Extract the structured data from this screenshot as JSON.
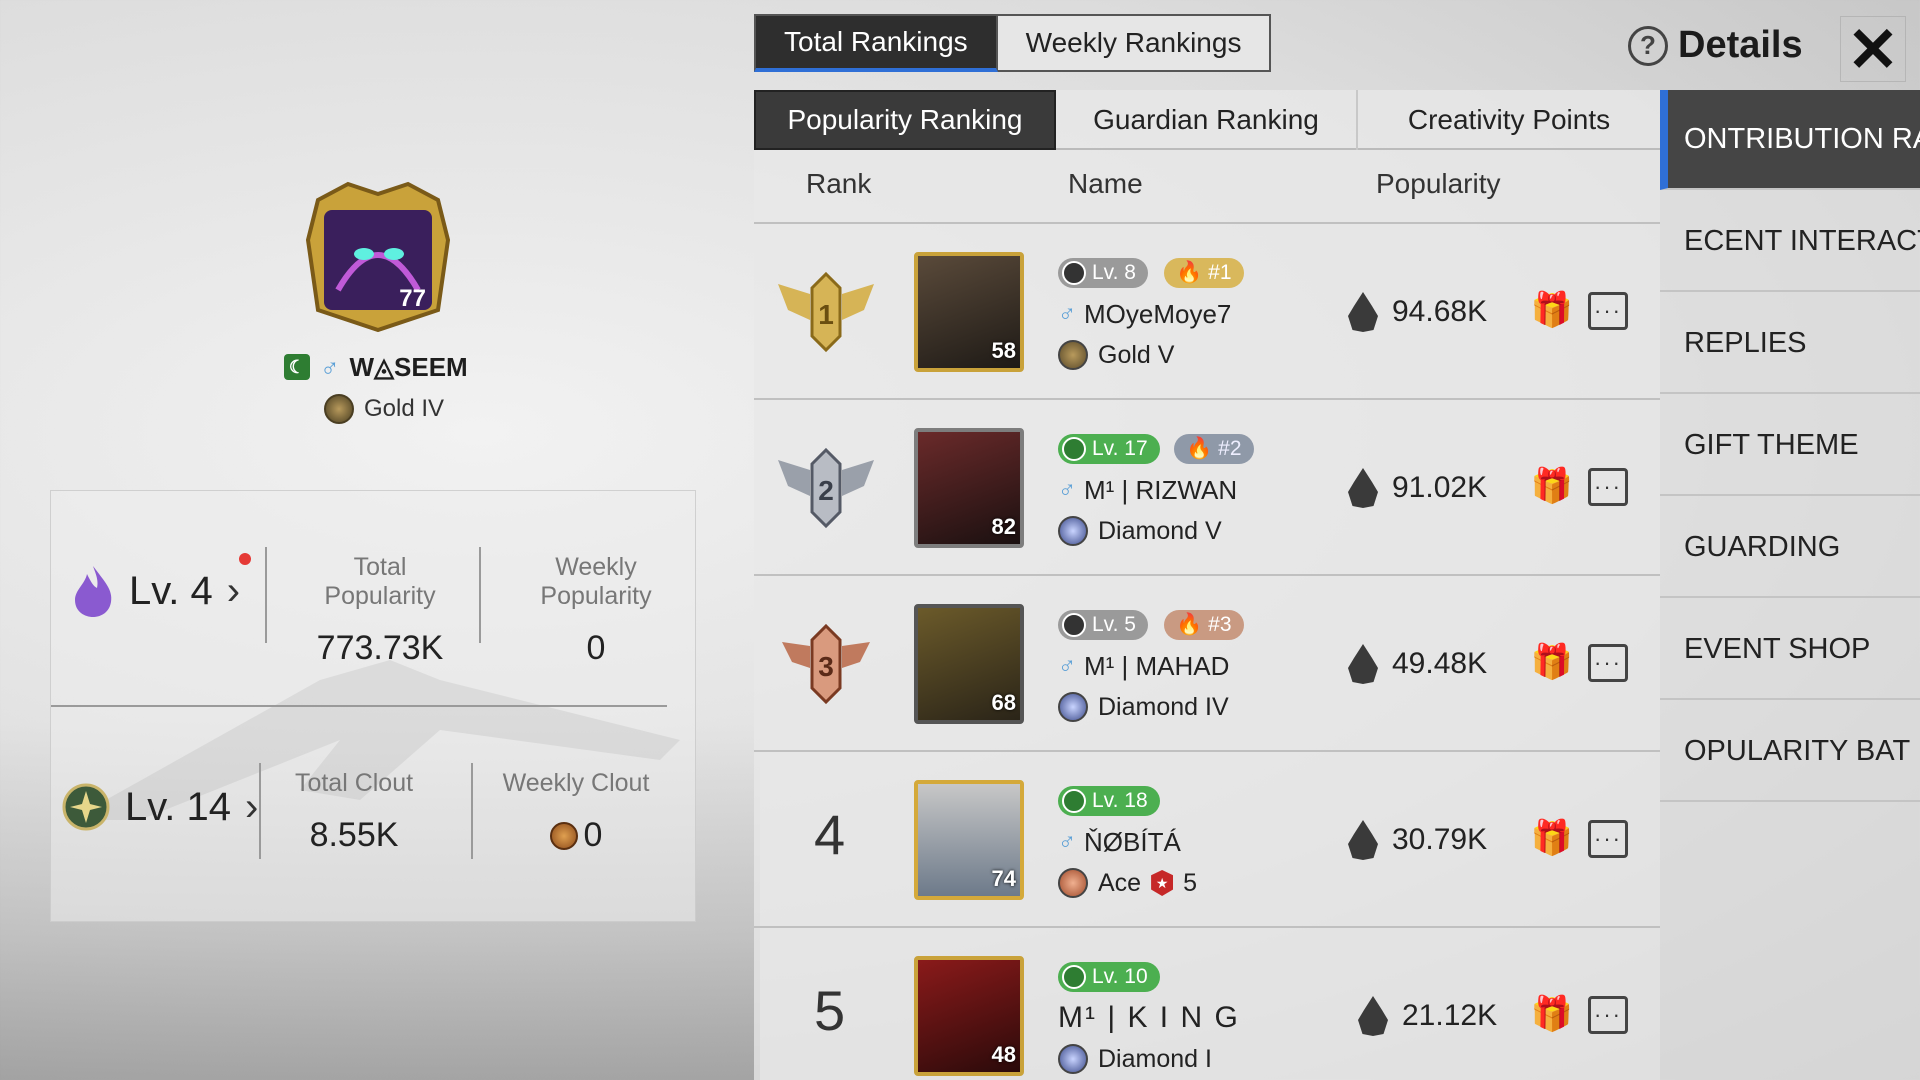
{
  "top_tabs": [
    {
      "label": "Total Rankings",
      "active": true
    },
    {
      "label": "Weekly Rankings",
      "active": false
    }
  ],
  "details_label": "Details",
  "close_icon": "close-icon",
  "profile": {
    "player_name": "W◬SEEM",
    "tier": "Gold IV",
    "avatar_level": "77",
    "popularity_level": "Lv. 4",
    "total_popularity_label": "Total Popularity",
    "total_popularity": "773.73K",
    "weekly_popularity_label": "Weekly Popularity",
    "weekly_popularity": "0",
    "clout_level": "Lv. 14",
    "total_clout_label": "Total Clout",
    "total_clout": "8.55K",
    "weekly_clout_label": "Weekly Clout",
    "weekly_clout": "0"
  },
  "sub_tabs": [
    {
      "label": "Popularity Ranking",
      "active": true
    },
    {
      "label": "Guardian Ranking",
      "active": false
    },
    {
      "label": "Creativity Points",
      "active": false
    }
  ],
  "columns": {
    "rank": "Rank",
    "name": "Name",
    "popularity": "Popularity"
  },
  "rows": [
    {
      "rank": "1",
      "avatar_level": "58",
      "level": "Lv. 8",
      "top": "#1",
      "name": "MOyeMoye7",
      "tier": "Gold V",
      "popularity": "94.68K"
    },
    {
      "rank": "2",
      "avatar_level": "82",
      "level": "Lv. 17",
      "top": "#2",
      "name": "M¹ | RIZWAN",
      "tier": "Diamond V",
      "popularity": "91.02K"
    },
    {
      "rank": "3",
      "avatar_level": "68",
      "level": "Lv. 5",
      "top": "#3",
      "name": "M¹ | MAHAD",
      "tier": "Diamond IV",
      "popularity": "49.48K"
    },
    {
      "rank": "4",
      "avatar_level": "74",
      "level": "Lv. 18",
      "top": "",
      "name": "ŇØBÍTÁ",
      "tier": "Ace",
      "tier_extra": "5",
      "popularity": "30.79K"
    },
    {
      "rank": "5",
      "avatar_level": "48",
      "level": "Lv. 10",
      "top": "",
      "name": "M¹ | K I N G",
      "tier": "Diamond I",
      "popularity": "21.12K"
    }
  ],
  "side_menu": [
    {
      "label": "ONTRIBUTION RANK",
      "active": true
    },
    {
      "label": "ECENT INTERACTION",
      "active": false
    },
    {
      "label": "REPLIES",
      "active": false
    },
    {
      "label": "GIFT THEME",
      "active": false
    },
    {
      "label": "GUARDING",
      "active": false
    },
    {
      "label": "EVENT SHOP",
      "active": false
    },
    {
      "label": "OPULARITY BAT",
      "active": false
    }
  ]
}
